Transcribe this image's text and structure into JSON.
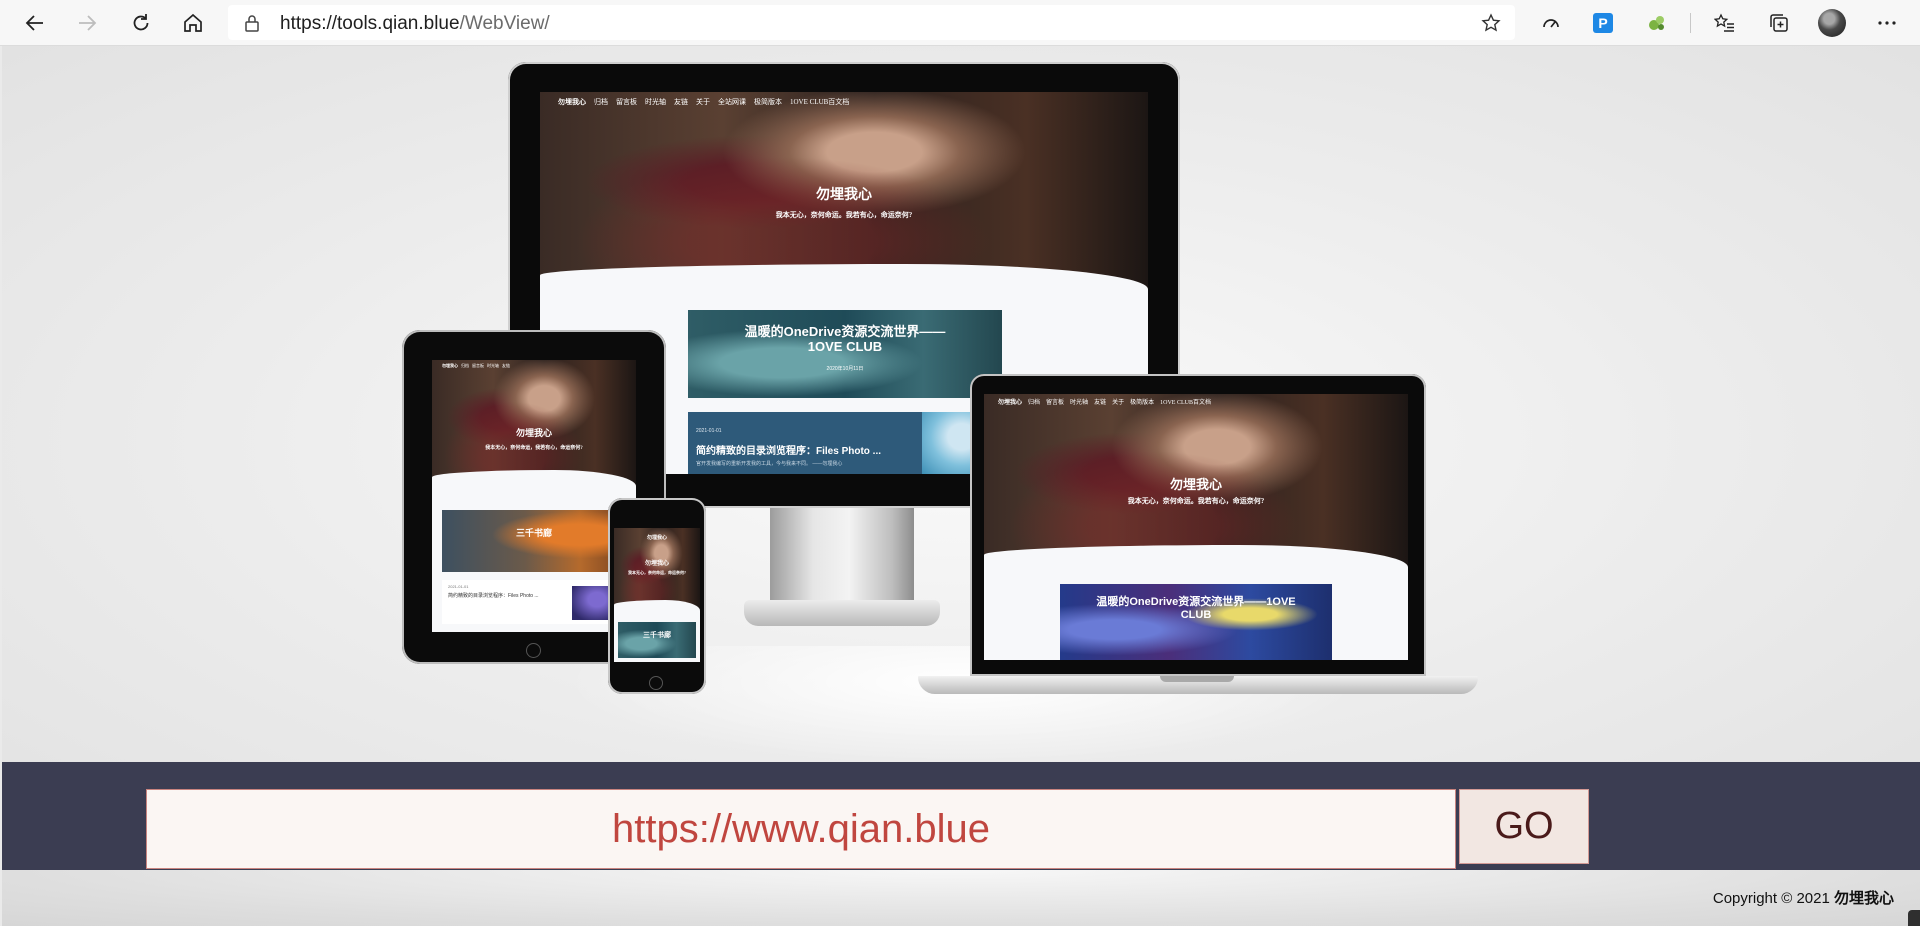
{
  "browser": {
    "url_host": "https://tools.qian.blue",
    "url_path": "/WebView/",
    "extension_badge": "P"
  },
  "site": {
    "brand": "勿埋我心",
    "nav": [
      "归档",
      "留言板",
      "时光轴",
      "友链",
      "关于",
      "全站网课",
      "极简版本",
      "1OVE CLUB百文档"
    ],
    "hero_title": "勿埋我心",
    "hero_subtitle": "我本无心，奈何命运。我若有心，命运奈何?",
    "hero_subtitle_short": "我本无心，奈何命运，我若有心，命运奈何?",
    "featured_title": "温暖的OneDrive资源交流世界——1OVE CLUB",
    "featured_meta": "2020年10月11日",
    "post_date": "2021-01-01",
    "post_title": "简约精致的目录浏览程序：Files Photo ...",
    "post_excerpt": "官开发我编写的重新开发我的工具，今与我来不同。 ——勿埋我心",
    "tablet_banner": "三千书廊",
    "phone_banner": "三千书廊",
    "phone_hero_sub": "我本无心，奈何命运，命运奈何?"
  },
  "form": {
    "url_value": "https://www.qian.blue",
    "go_label": "GO"
  },
  "footer": {
    "copyright_prefix": "Copyright © 2021",
    "copyright_owner": "勿埋我心"
  }
}
